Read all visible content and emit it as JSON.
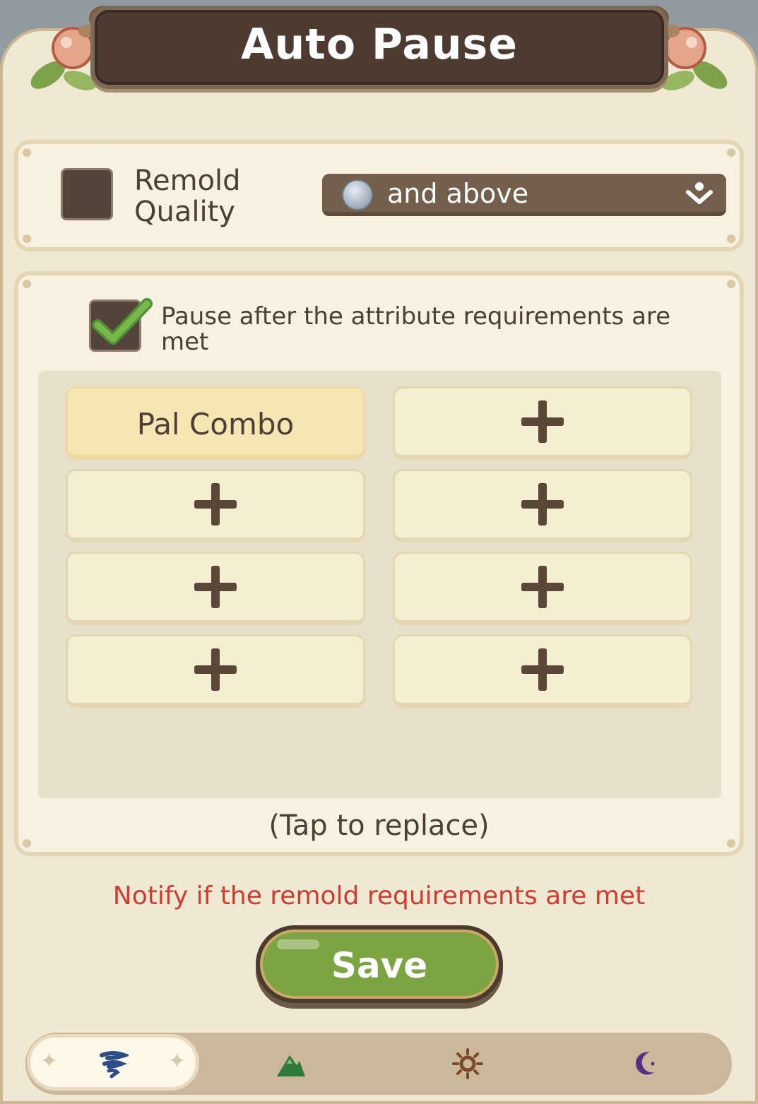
{
  "header": {
    "title": "Auto Pause"
  },
  "quality": {
    "checked": false,
    "label_line1": "Remold",
    "label_line2": "Quality",
    "dropdown_value": "and above",
    "dropdown_gem": "silver-gem-icon"
  },
  "attribute_pause": {
    "checked": true,
    "label": "Pause after the attribute requirements are met"
  },
  "slots": [
    {
      "label": "Pal Combo"
    },
    {
      "label": ""
    },
    {
      "label": ""
    },
    {
      "label": ""
    },
    {
      "label": ""
    },
    {
      "label": ""
    },
    {
      "label": ""
    },
    {
      "label": ""
    }
  ],
  "tap_hint": "(Tap to replace)",
  "notify_text": "Notify if the remold requirements are met",
  "save_label": "Save",
  "tabs": [
    {
      "icon": "wind-icon",
      "active": true
    },
    {
      "icon": "mountain-icon",
      "active": false
    },
    {
      "icon": "sun-icon",
      "active": false
    },
    {
      "icon": "moon-icon",
      "active": false
    }
  ],
  "colors": {
    "accent_green": "#7da443",
    "alert_red": "#d23b30",
    "panel": "#efe8d2",
    "banner": "#4d3b31"
  }
}
